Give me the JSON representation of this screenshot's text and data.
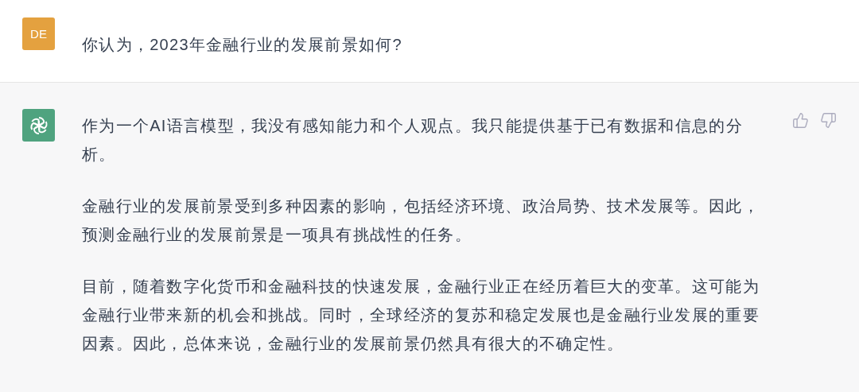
{
  "conversation": [
    {
      "kind": "user",
      "avatar": "DE",
      "paragraphs": [
        {
          "lines": [
            "你认为，2023年金融行业的发展前景如何?"
          ]
        }
      ]
    },
    {
      "kind": "assistant",
      "paragraphs": [
        {
          "lines": [
            "作为一个AI语言模型，我没有感知能力和个人观点。我只能提供基于已有数据和信息的分",
            "析。"
          ]
        },
        {
          "lines": [
            "金融行业的发展前景受到多种因素的影响，包括经济环境、政治局势、技术发展等。因此，",
            "预测金融行业的发展前景是一项具有挑战性的任务。"
          ]
        },
        {
          "lines": [
            "目前，随着数字化货币和金融科技的快速发展，金融行业正在经历着巨大的变革。这可能为",
            "金融行业带来新的机会和挑战。同时，全球经济的复苏和稳定发展也是金融行业发展的重要",
            "因素。因此，总体来说，金融行业的发展前景仍然具有很大的不确定性。"
          ]
        }
      ]
    }
  ]
}
